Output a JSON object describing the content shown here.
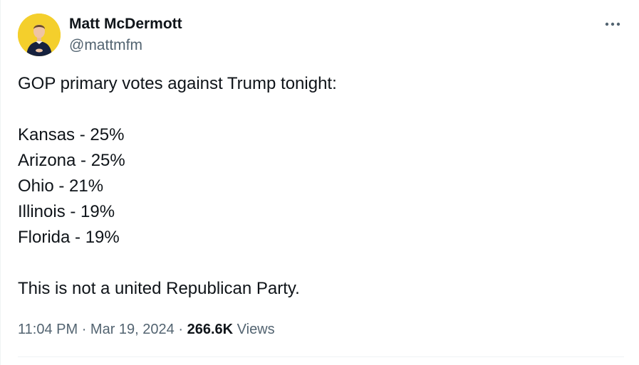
{
  "author": {
    "display_name": "Matt McDermott",
    "handle": "@mattmfm",
    "avatar_icon": "profile-photo-icon",
    "avatar_bg": "#f4cf2c"
  },
  "more_icon": "more-horizontal-icon",
  "tweet": {
    "lines": [
      "GOP primary votes against Trump tonight:",
      "",
      "Kansas - 25%",
      "Arizona - 25%",
      "Ohio - 21%",
      "Illinois - 19%",
      "Florida - 19%",
      "",
      "This is not a united Republican Party."
    ]
  },
  "meta": {
    "time": "11:04 PM",
    "separator": "·",
    "date": "Mar 19, 2024",
    "views_count": "266.6K",
    "views_label": "Views"
  },
  "colors": {
    "text_primary": "#0f1419",
    "text_secondary": "#536471",
    "divider": "#eff3f4"
  }
}
